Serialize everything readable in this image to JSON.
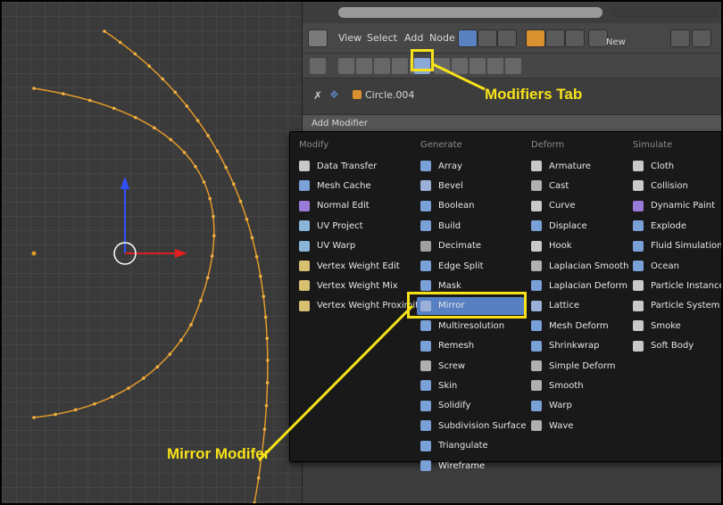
{
  "header": {
    "menu_view": "View",
    "menu_select": "Select",
    "menu_add": "Add",
    "menu_node": "Node",
    "new_label": "New"
  },
  "context": {
    "object_name": "Circle.004"
  },
  "add_modifier_label": "Add Modifier",
  "annotations": {
    "modifiers_tab": "Modifiers Tab",
    "mirror_modifier": "Mirror Modifer",
    "color": "#f7e21a"
  },
  "menu": {
    "columns": [
      {
        "heading": "Modify",
        "items": [
          {
            "label": "Data Transfer",
            "icon": "data-transfer-icon",
            "color": "#c9c9c9"
          },
          {
            "label": "Mesh Cache",
            "icon": "mesh-cache-icon",
            "color": "#7aa0d8"
          },
          {
            "label": "Normal Edit",
            "icon": "normal-edit-icon",
            "color": "#9a7ad8"
          },
          {
            "label": "UV Project",
            "icon": "uv-project-icon",
            "color": "#8ab4d8"
          },
          {
            "label": "UV Warp",
            "icon": "uv-warp-icon",
            "color": "#8ab4d8"
          },
          {
            "label": "Vertex Weight Edit",
            "icon": "vertex-weight-edit-icon",
            "color": "#d8c070"
          },
          {
            "label": "Vertex Weight Mix",
            "icon": "vertex-weight-mix-icon",
            "color": "#d8c070"
          },
          {
            "label": "Vertex Weight Proximity",
            "icon": "vertex-weight-proximity-icon",
            "color": "#d8c070"
          }
        ]
      },
      {
        "heading": "Generate",
        "items": [
          {
            "label": "Array",
            "icon": "array-icon",
            "color": "#7aa0d8"
          },
          {
            "label": "Bevel",
            "icon": "bevel-icon",
            "color": "#9ab0d8"
          },
          {
            "label": "Boolean",
            "icon": "boolean-icon",
            "color": "#7aa0d8"
          },
          {
            "label": "Build",
            "icon": "build-icon",
            "color": "#7aa0d8"
          },
          {
            "label": "Decimate",
            "icon": "decimate-icon",
            "color": "#a0a0a0"
          },
          {
            "label": "Edge Split",
            "icon": "edge-split-icon",
            "color": "#7aa0d8"
          },
          {
            "label": "Mask",
            "icon": "mask-icon",
            "color": "#7aa0d8"
          },
          {
            "label": "Mirror",
            "icon": "mirror-icon",
            "color": "#9ab0d8",
            "highlighted": true
          },
          {
            "label": "Multiresolution",
            "icon": "multiresolution-icon",
            "color": "#7aa0d8"
          },
          {
            "label": "Remesh",
            "icon": "remesh-icon",
            "color": "#7aa0d8"
          },
          {
            "label": "Screw",
            "icon": "screw-icon",
            "color": "#b0b0b0"
          },
          {
            "label": "Skin",
            "icon": "skin-icon",
            "color": "#7aa0d8"
          },
          {
            "label": "Solidify",
            "icon": "solidify-icon",
            "color": "#7aa0d8"
          },
          {
            "label": "Subdivision Surface",
            "icon": "subdivision-surface-icon",
            "color": "#7aa0d8"
          },
          {
            "label": "Triangulate",
            "icon": "triangulate-icon",
            "color": "#7aa0d8"
          },
          {
            "label": "Wireframe",
            "icon": "wireframe-icon",
            "color": "#7aa0d8"
          }
        ]
      },
      {
        "heading": "Deform",
        "items": [
          {
            "label": "Armature",
            "icon": "armature-icon",
            "color": "#c9c9c9"
          },
          {
            "label": "Cast",
            "icon": "cast-icon",
            "color": "#b0b0b0"
          },
          {
            "label": "Curve",
            "icon": "curve-icon",
            "color": "#c9c9c9"
          },
          {
            "label": "Displace",
            "icon": "displace-icon",
            "color": "#7aa0d8"
          },
          {
            "label": "Hook",
            "icon": "hook-icon",
            "color": "#c9c9c9"
          },
          {
            "label": "Laplacian Smooth",
            "icon": "laplacian-smooth-icon",
            "color": "#b0b0b0"
          },
          {
            "label": "Laplacian Deform",
            "icon": "laplacian-deform-icon",
            "color": "#7aa0d8"
          },
          {
            "label": "Lattice",
            "icon": "lattice-icon",
            "color": "#9ab0d8"
          },
          {
            "label": "Mesh Deform",
            "icon": "mesh-deform-icon",
            "color": "#7aa0d8"
          },
          {
            "label": "Shrinkwrap",
            "icon": "shrinkwrap-icon",
            "color": "#7aa0d8"
          },
          {
            "label": "Simple Deform",
            "icon": "simple-deform-icon",
            "color": "#b0b0b0"
          },
          {
            "label": "Smooth",
            "icon": "smooth-icon",
            "color": "#b0b0b0"
          },
          {
            "label": "Warp",
            "icon": "warp-icon",
            "color": "#7aa0d8"
          },
          {
            "label": "Wave",
            "icon": "wave-icon",
            "color": "#b0b0b0"
          }
        ]
      },
      {
        "heading": "Simulate",
        "items": [
          {
            "label": "Cloth",
            "icon": "cloth-icon",
            "color": "#c9c9c9"
          },
          {
            "label": "Collision",
            "icon": "collision-icon",
            "color": "#c9c9c9"
          },
          {
            "label": "Dynamic Paint",
            "icon": "dynamic-paint-icon",
            "color": "#9a7ad8"
          },
          {
            "label": "Explode",
            "icon": "explode-icon",
            "color": "#7aa0d8"
          },
          {
            "label": "Fluid Simulation",
            "icon": "fluid-simulation-icon",
            "color": "#7aa0d8"
          },
          {
            "label": "Ocean",
            "icon": "ocean-icon",
            "color": "#7aa0d8"
          },
          {
            "label": "Particle Instance",
            "icon": "particle-instance-icon",
            "color": "#c9c9c9"
          },
          {
            "label": "Particle System",
            "icon": "particle-system-icon",
            "color": "#c9c9c9"
          },
          {
            "label": "Smoke",
            "icon": "smoke-icon",
            "color": "#c9c9c9"
          },
          {
            "label": "Soft Body",
            "icon": "soft-body-icon",
            "color": "#c9c9c9"
          }
        ]
      }
    ]
  }
}
